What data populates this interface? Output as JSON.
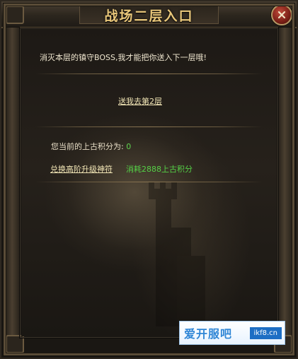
{
  "window": {
    "title": "战场二层入口",
    "close_icon": "close-x-icon"
  },
  "main": {
    "message": "消灭本层的镇守BOSS,我才能把你送入下一层哦!",
    "teleport_link": "送我去第2层",
    "points_label": "您当前的上古积分为:",
    "points_value": "0",
    "exchange_link": "兑换高阶升级神符",
    "exchange_cost": "消耗2888上古积分"
  },
  "watermark": {
    "brand": "爱开服吧",
    "domain": "ikf8.cn"
  },
  "colors": {
    "title": "#e9c77a",
    "link": "#f2e6b6",
    "highlight_green": "#54d046",
    "frame": "#5a4c37",
    "close_button": "#7a1f16"
  }
}
